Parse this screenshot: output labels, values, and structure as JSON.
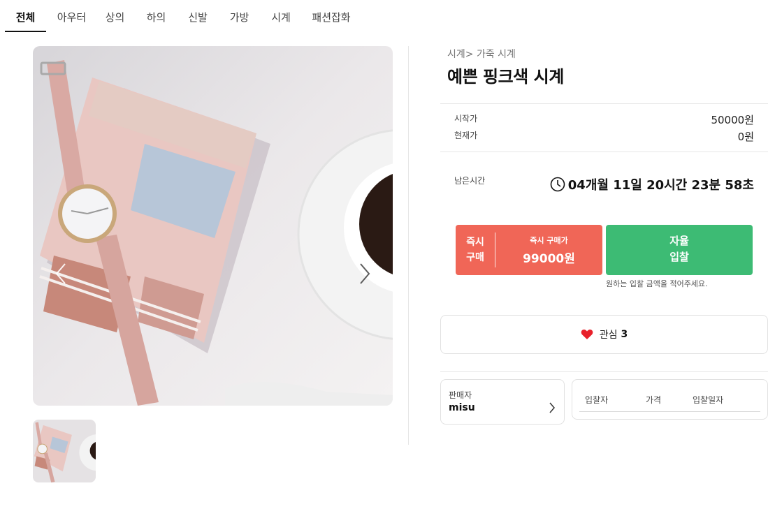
{
  "tabs": [
    {
      "label": "전체",
      "active": true
    },
    {
      "label": "아우터"
    },
    {
      "label": "상의"
    },
    {
      "label": "하의"
    },
    {
      "label": "신발"
    },
    {
      "label": "가방"
    },
    {
      "label": "시계"
    },
    {
      "label": "패션잡화"
    }
  ],
  "product": {
    "breadcrumb": "시계> 가죽 시계",
    "title": "예쁜 핑크색 시계"
  },
  "price": {
    "start_label": "시작가",
    "start_value": "50000원",
    "current_label": "현재가",
    "current_value": "0원"
  },
  "timer": {
    "label": "남은시간",
    "value": "04개월 11일 20시간 23분 58초",
    "icon": "clock-icon"
  },
  "buy_now": {
    "line1": "즉시",
    "line2": "구매",
    "caption": "즉시 구매가",
    "price": "99000원",
    "color": "#f06657"
  },
  "bid": {
    "line1": "자율",
    "line2": "입찰",
    "hint": "원하는 입찰 금액을 적어주세요.",
    "color": "#3dbb74"
  },
  "like": {
    "label": "관심",
    "count": "3",
    "icon": "heart-icon",
    "color": "#e8202a"
  },
  "seller": {
    "label": "판매자",
    "name": "misu",
    "icon": "chevron-right-icon"
  },
  "bids_table": {
    "columns": [
      "입찰자",
      "가격",
      "입찰일자"
    ],
    "rows": []
  },
  "gallery": {
    "prev_icon": "chevron-left-icon",
    "next_icon": "chevron-right-icon"
  }
}
